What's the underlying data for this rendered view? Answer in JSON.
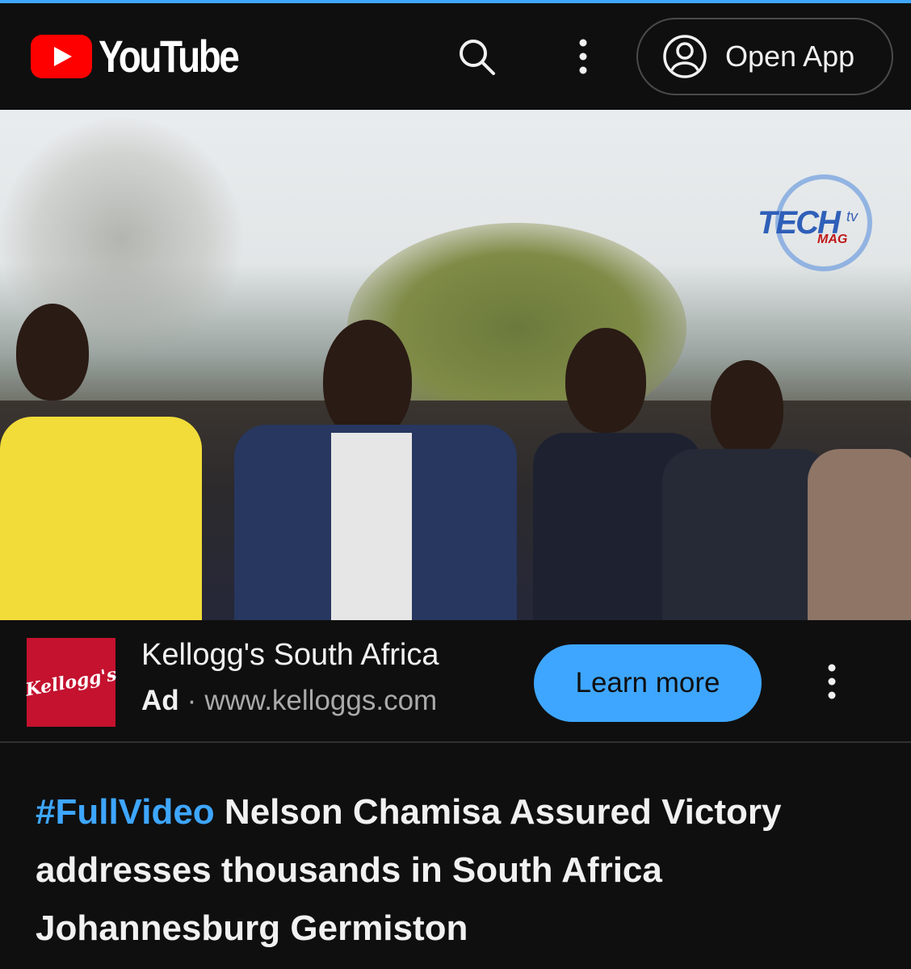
{
  "header": {
    "logo_text": "YouTube",
    "open_app_label": "Open App"
  },
  "video": {
    "watermark_text": "TECH",
    "watermark_tv": "tv",
    "watermark_mag": "MAG"
  },
  "ad": {
    "thumb_text": "Kellogg's",
    "advertiser": "Kellogg's South Africa",
    "badge": "Ad",
    "separator": "·",
    "url": "www.kelloggs.com",
    "cta_label": "Learn more"
  },
  "video_title": {
    "hashtag": "#FullVideo",
    "text": " Nelson Chamisa Assured Victory addresses thousands in South Africa Johannesburg Germiston"
  },
  "colors": {
    "accent": "#3ea6ff",
    "brand_red": "#ff0000",
    "ad_thumb": "#c4122f",
    "background": "#0f0f0f"
  },
  "icons": [
    "youtube-logo-icon",
    "search-icon",
    "more-vert-icon",
    "account-icon",
    "kelloggs-logo",
    "more-vert-icon"
  ]
}
